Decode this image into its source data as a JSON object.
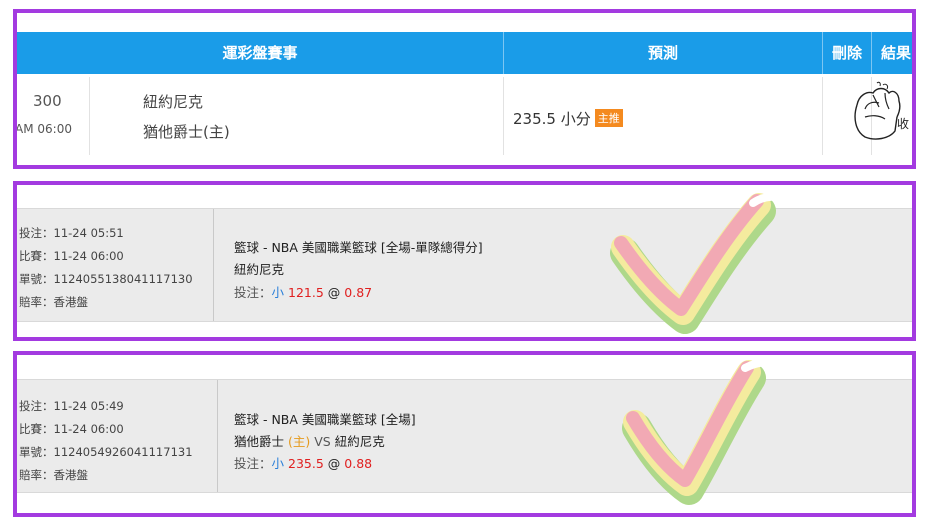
{
  "panel1": {
    "header": {
      "event_col": "運彩盤賽事",
      "prediction_col": "預測",
      "delete_col": "刪除",
      "result_col": "結果"
    },
    "row": {
      "number": "300",
      "time": "AM 06:00",
      "team_away": "紐約尼克",
      "team_home": "猶他爵士(主)",
      "prediction_value": "235.5 小分",
      "prediction_badge": "主推",
      "result_note": "收"
    }
  },
  "panel2": {
    "bet_time_label": "投注：",
    "bet_time": "11-24 05:51",
    "match_time_label": "比賽：",
    "match_time": "11-24 06:00",
    "ticket_label": "單號：",
    "ticket_no": "1124055138041117130",
    "odds_type_label": "賠率：",
    "odds_type": "香港盤",
    "market": "籃球 - NBA 美國職業籃球 [全場-單隊總得分]",
    "team": "紐約尼克",
    "pick_label": "投注：",
    "pick_side": "小",
    "pick_line": "121.5",
    "at": "@",
    "odds": "0.87"
  },
  "panel3": {
    "bet_time_label": "投注：",
    "bet_time": "11-24 05:49",
    "match_time_label": "比賽：",
    "match_time": "11-24 06:00",
    "ticket_label": "單號：",
    "ticket_no": "1124054926041117131",
    "odds_type_label": "賠率：",
    "odds_type": "香港盤",
    "market": "籃球 - NBA 美國職業籃球 [全場]",
    "team_home": "猶他爵士",
    "home_tag": "(主)",
    "vs": "VS",
    "team_away": "紐約尼克",
    "pick_label": "投注：",
    "pick_side": "小",
    "pick_line": "235.5",
    "at": "@",
    "odds": "0.88"
  }
}
